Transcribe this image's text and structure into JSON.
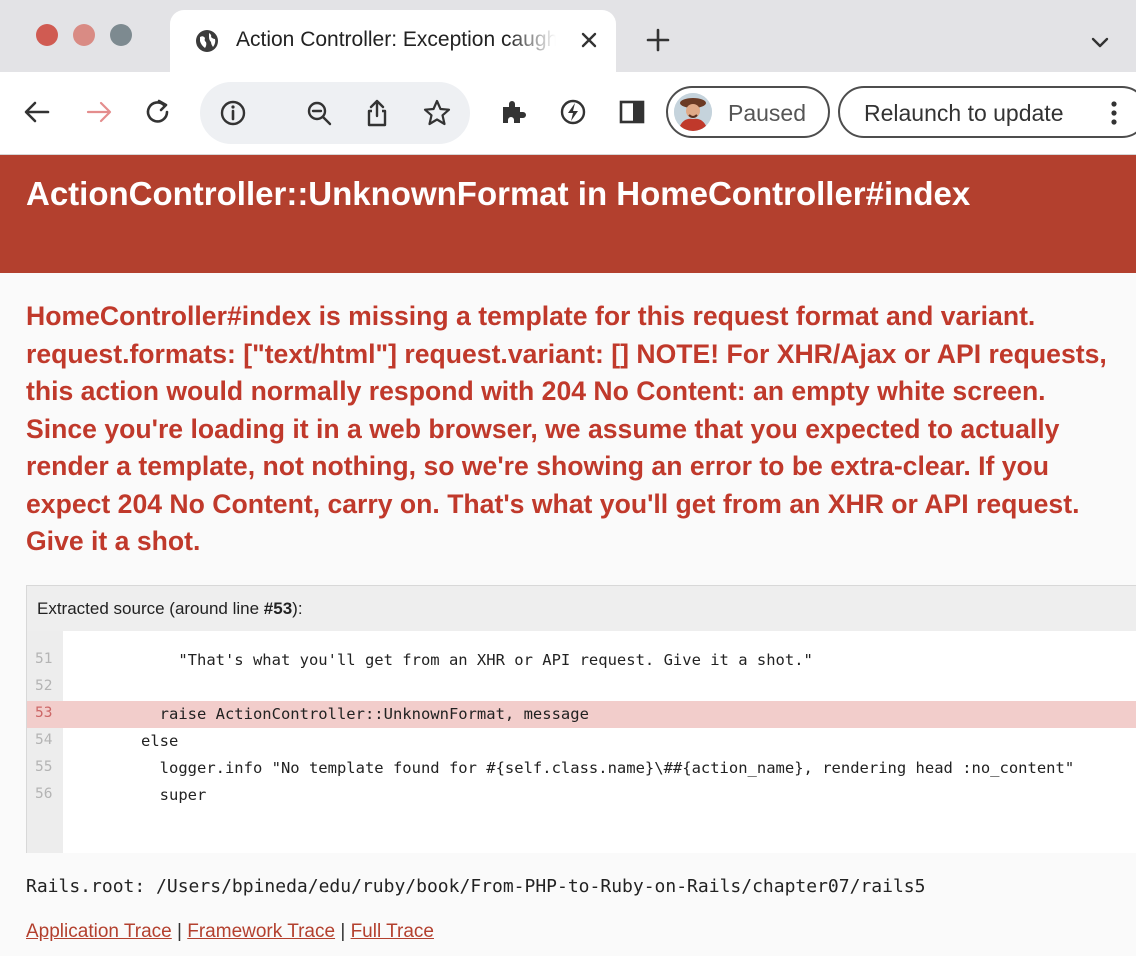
{
  "browser": {
    "tab_title": "Action Controller: Exception caught",
    "profile_label": "Paused",
    "relaunch_label": "Relaunch to update"
  },
  "page": {
    "title": "ActionController::UnknownFormat in HomeController#index",
    "error_message": "HomeController#index is missing a template for this request format and variant. request.formats: [\"text/html\"] request.variant: [] NOTE! For XHR/Ajax or API requests, this action would normally respond with 204 No Content: an empty white screen. Since you're loading it in a web browser, we assume that you expected to actually render a template, not nothing, so we're showing an error to be extra-clear. If you expect 204 No Content, carry on. That's what you'll get from an XHR or API request. Give it a shot.",
    "source": {
      "label_prefix": "Extracted source (around line ",
      "line_ref": "#53",
      "label_suffix": "):",
      "lines": [
        {
          "num": "51",
          "text": "          \"That's what you'll get from an XHR or API request. Give it a shot.\""
        },
        {
          "num": "52",
          "text": ""
        },
        {
          "num": "53",
          "text": "        raise ActionController::UnknownFormat, message"
        },
        {
          "num": "54",
          "text": "      else"
        },
        {
          "num": "55",
          "text": "        logger.info \"No template found for #{self.class.name}\\##{action_name}, rendering head :no_content\""
        },
        {
          "num": "56",
          "text": "        super"
        }
      ]
    },
    "rails_root": "Rails.root: /Users/bpineda/edu/ruby/book/From-PHP-to-Ruby-on-Rails/chapter07/rails5",
    "traces": {
      "application": "Application Trace",
      "framework": "Framework Trace",
      "full": "Full Trace",
      "separator": "|"
    }
  },
  "colors": {
    "header_bg": "#b3402e",
    "error_text": "#c0392b",
    "highlight_line": "#f2cdcb",
    "link": "#b3402e"
  },
  "icons": [
    "globe-icon",
    "close-icon",
    "plus-icon",
    "chevron-down-icon",
    "back-arrow-icon",
    "forward-arrow-icon",
    "reload-icon",
    "info-icon",
    "zoom-out-icon",
    "share-icon",
    "star-icon",
    "extensions-icon",
    "performance-icon",
    "sidepanel-icon",
    "kebab-menu-icon"
  ]
}
